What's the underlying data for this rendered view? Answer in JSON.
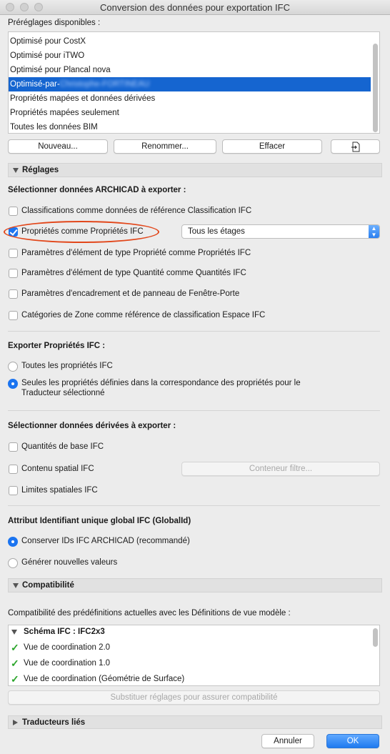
{
  "window": {
    "title": "Conversion des données pour exportation IFC"
  },
  "presets": {
    "heading": "Préréglages disponibles :",
    "items": [
      {
        "label": "Optimisé pour CostX",
        "selected": false
      },
      {
        "label": "Optimisé pour iTWO",
        "selected": false
      },
      {
        "label": "Optimisé pour Plancal nova",
        "selected": false
      },
      {
        "label": "Optimisé-par-",
        "label_obscured": "Christophe-FORTINEAU",
        "selected": true
      },
      {
        "label": "Propriétés mapées et données dérivées",
        "selected": false
      },
      {
        "label": "Propriétés mapées seulement",
        "selected": false
      },
      {
        "label": "Toutes les données BIM",
        "selected": false
      }
    ],
    "buttons": {
      "new": "Nouveau...",
      "rename": "Renommer...",
      "delete": "Effacer"
    }
  },
  "settings": {
    "section_title": "Réglages",
    "select_data": {
      "heading": "Sélectionner données ARCHICAD à exporter :",
      "options": [
        {
          "label": "Classifications comme données de référence Classification IFC",
          "checked": false
        },
        {
          "label": "Propriétés comme Propriétés IFC",
          "checked": true
        },
        {
          "label": "Paramètres d'élément de type Propriété comme Propriétés IFC",
          "checked": false
        },
        {
          "label": "Paramètres d'élément de type Quantité comme Quantités IFC",
          "checked": false
        },
        {
          "label": "Paramètres d'encadrement et de panneau de Fenêtre-Porte",
          "checked": false
        },
        {
          "label": "Catégories de Zone comme référence de classification Espace IFC",
          "checked": false
        }
      ],
      "storey_select": "Tous les étages"
    },
    "export_props": {
      "heading": "Exporter Propriétés IFC :",
      "options": [
        {
          "label": "Toutes les propriétés IFC",
          "selected": false
        },
        {
          "label": "Seules les propriétés définies dans la correspondance des propriétés pour le",
          "label_line2": "Traducteur sélectionné",
          "selected": true
        }
      ]
    },
    "derived": {
      "heading": "Sélectionner données dérivées à exporter :",
      "options": [
        {
          "label": "Quantités de base IFC",
          "checked": false
        },
        {
          "label": "Contenu spatial IFC",
          "checked": false
        },
        {
          "label": "Limites spatiales IFC",
          "checked": false
        }
      ],
      "filter_button": "Conteneur filtre..."
    },
    "guid": {
      "heading": "Attribut Identifiant unique global IFC (GlobalId)",
      "options": [
        {
          "label": "Conserver IDs IFC ARCHICAD (recommandé)",
          "selected": true
        },
        {
          "label": "Générer nouvelles valeurs",
          "selected": false
        }
      ]
    }
  },
  "compatibility": {
    "section_title": "Compatibilité",
    "description": "Compatibilité des prédéfinitions actuelles avec les Définitions de vue modèle :",
    "schema": "Schéma IFC : IFC2x3",
    "items": [
      "Vue de coordination 2.0",
      "Vue de coordination 1.0",
      "Vue de coordination (Géométrie de Surface)"
    ],
    "substitute_button": "Substituer réglages pour assurer compatibilité"
  },
  "linked": {
    "section_title": "Traducteurs liés"
  },
  "footer": {
    "cancel": "Annuler",
    "ok": "OK"
  },
  "colors": {
    "accent": "#1565d0",
    "highlight_ring": "#e2471b",
    "check": "#2aa52a"
  }
}
